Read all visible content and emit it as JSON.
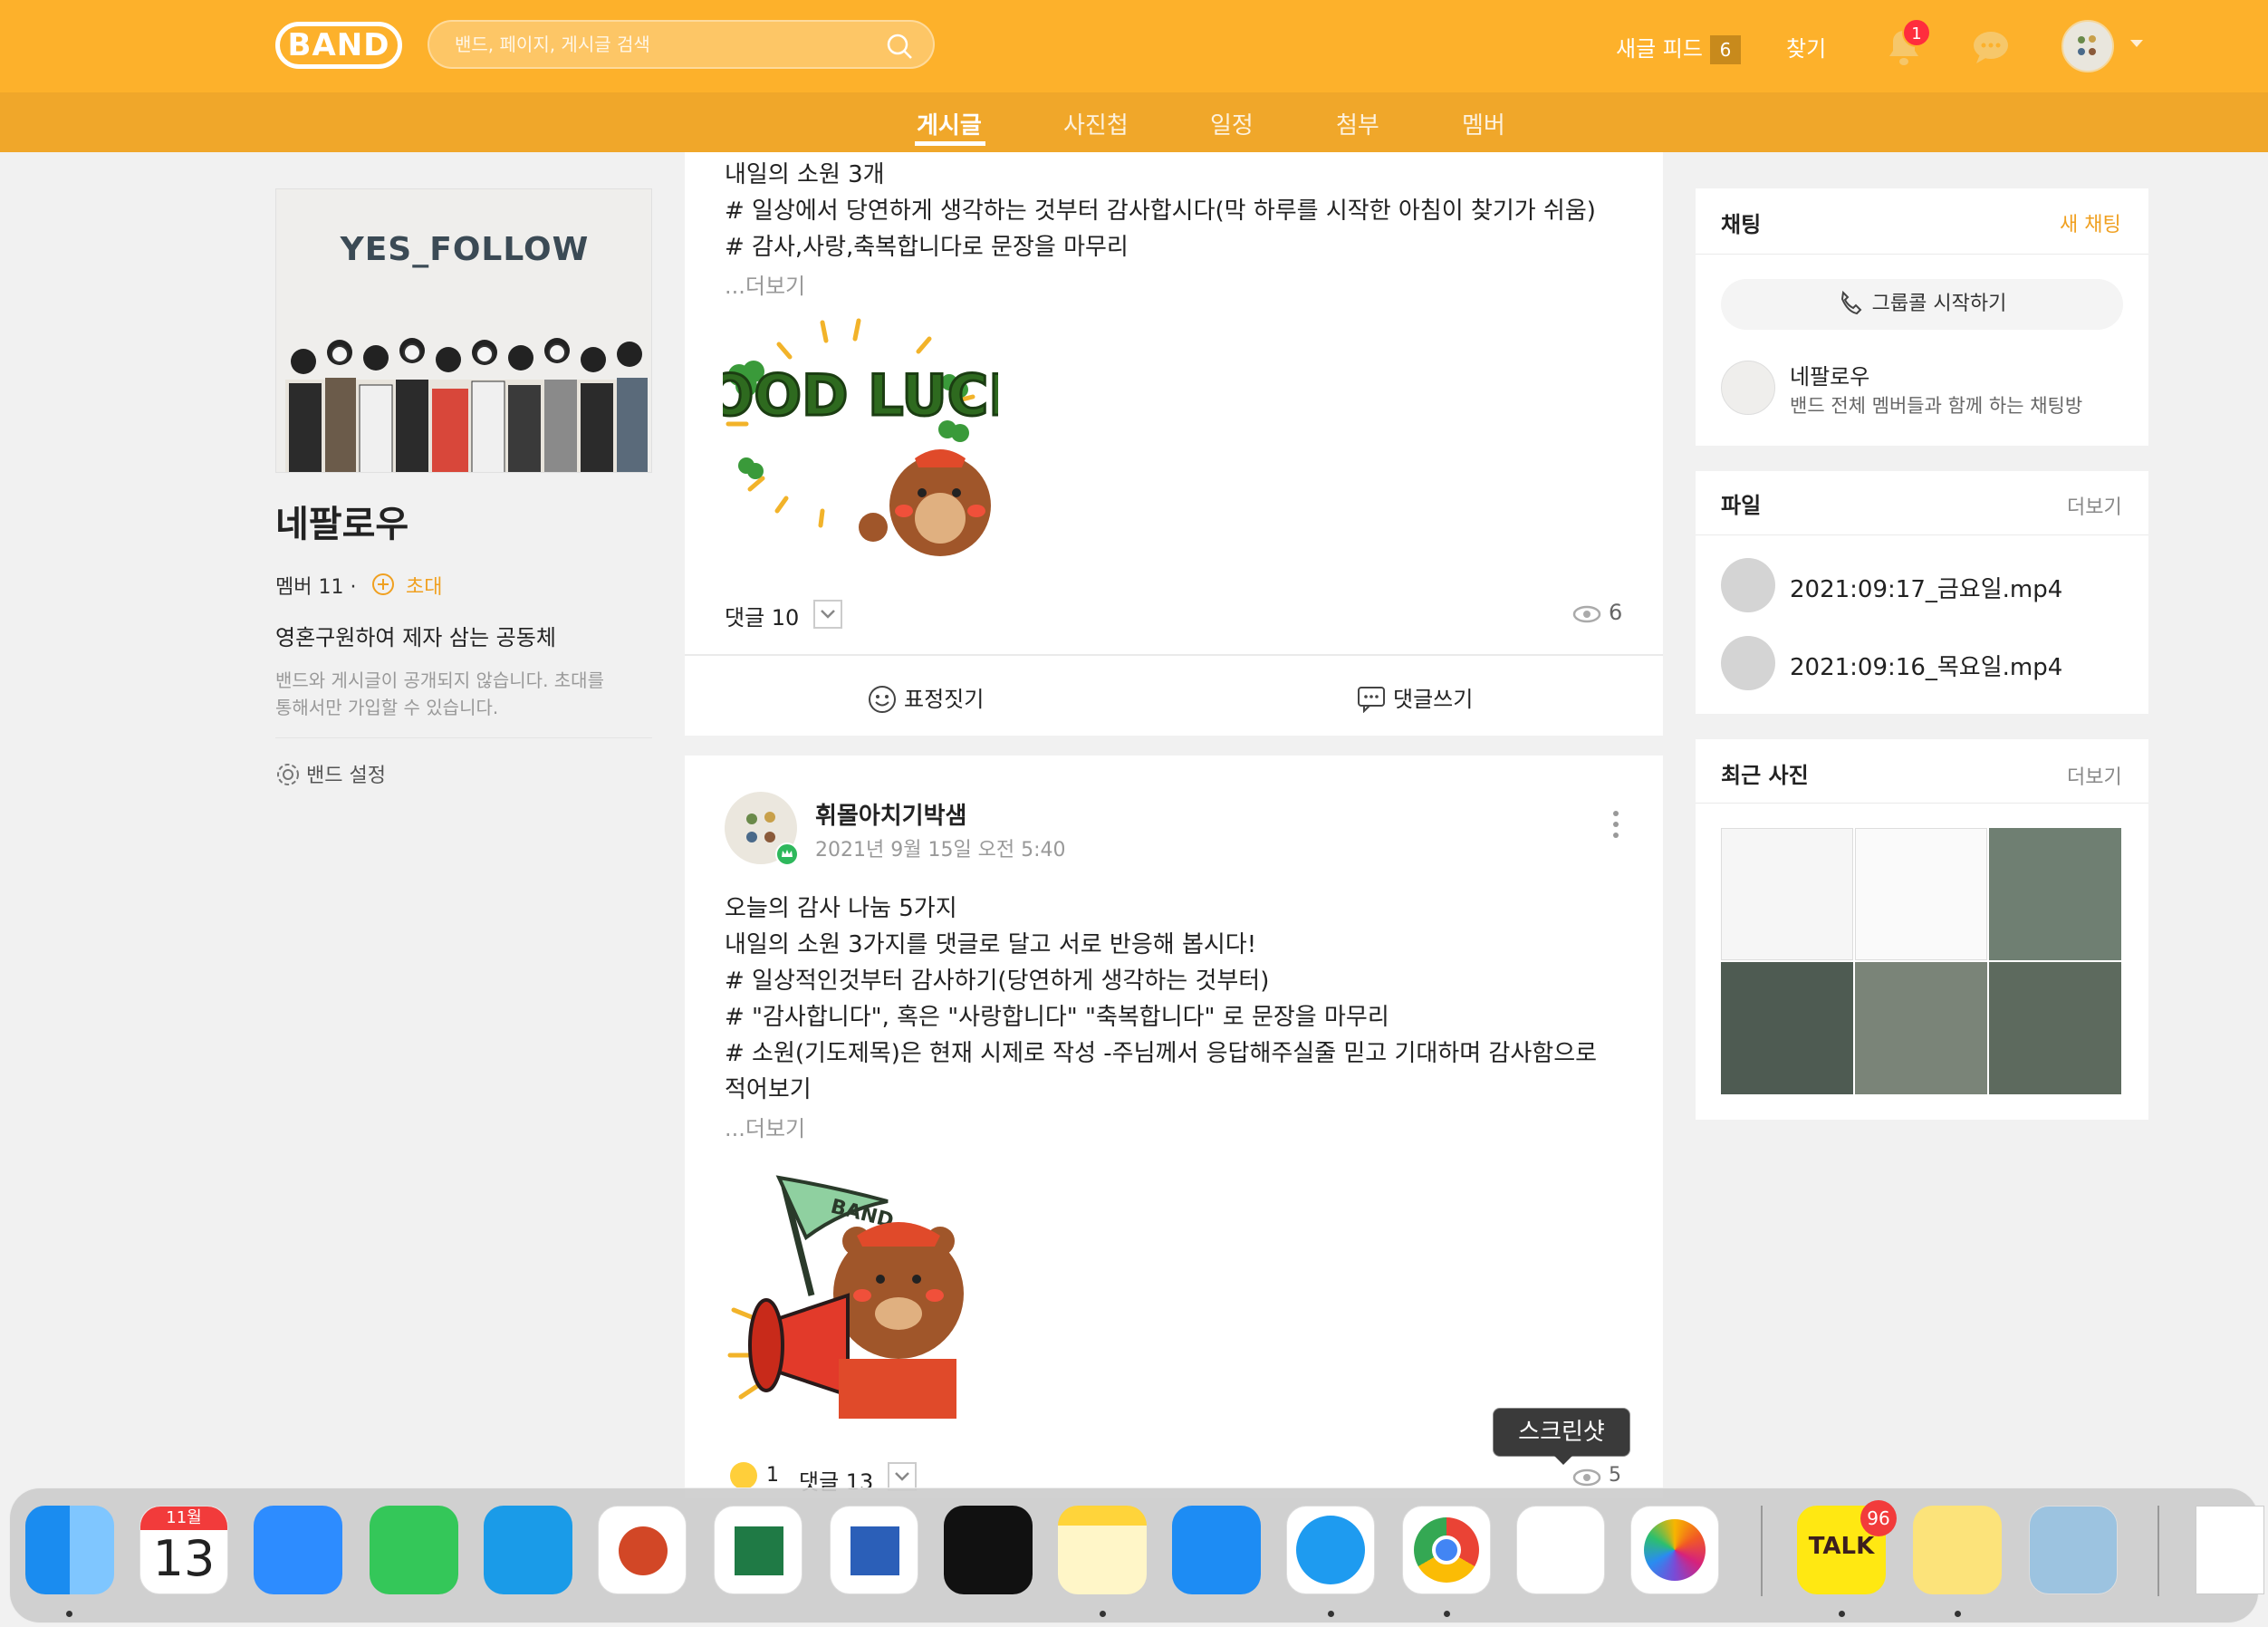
{
  "header": {
    "logo": "BAND",
    "search_placeholder": "밴드, 페이지, 게시글 검색",
    "feed_label": "새글 피드",
    "feed_count": "6",
    "find_label": "찾기",
    "notification_count": "1"
  },
  "tabs": [
    {
      "label": "게시글",
      "active": true
    },
    {
      "label": "사진첩"
    },
    {
      "label": "일정"
    },
    {
      "label": "첨부"
    },
    {
      "label": "멤버"
    }
  ],
  "band": {
    "cover_title": "YES_FOLLOW",
    "name": "네팔로우",
    "members": "멤버 11 ·",
    "invite": "초대",
    "description": "영혼구원하여 제자 삼는 공동체",
    "privacy_line1": "밴드와 게시글이 공개되지 않습니다. 초대를",
    "privacy_line2": "통해서만 가입할 수 있습니다.",
    "settings": "밴드 설정"
  },
  "post1": {
    "lines": [
      "내일의 소원 3개",
      "# 일상에서 당연하게 생각하는 것부터 감사합시다(막 하루를 시작한 아침이 찾기가 쉬움)",
      "# 감사,사랑,축복합니다로 문장을 마무리"
    ],
    "more": "...더보기",
    "sticker_text": "GOOD LUCK",
    "comments": "댓글 10",
    "views": "6",
    "react_label": "표정짓기",
    "comment_label": "댓글쓰기"
  },
  "post2": {
    "author": "휘몰아치기박샘",
    "date": "2021년 9월 15일 오전 5:40",
    "lines": [
      "오늘의 감사 나눔 5가지",
      "내일의 소원 3가지를 댓글로 달고 서로 반응해 봅시다!",
      "# 일상적인것부터 감사하기(당연하게 생각하는 것부터)",
      "# \"감사합니다\", 혹은 \"사랑합니다\" \"축복합니다\" 로 문장을 마무리",
      "#  소원(기도제목)은 현재 시제로 작성 -주님께서 응답해주실줄 믿고 기대하며 감사함으로",
      "적어보기"
    ],
    "more": "...더보기",
    "sticker_text": "BAND",
    "reaction_count": "1",
    "comments": "댓글 13",
    "views": "5"
  },
  "chat_widget": {
    "title": "채팅",
    "new_chat": "새 채팅",
    "group_call": "그룹콜 시작하기",
    "room_name": "네팔로우",
    "room_desc": "밴드 전체 멤버들과 함께 하는 채팅방"
  },
  "files_widget": {
    "title": "파일",
    "more": "더보기",
    "files": [
      "2021:09:17_금요일.mp4",
      "2021:09:16_목요일.mp4"
    ]
  },
  "photos_widget": {
    "title": "최근 사진",
    "more": "더보기"
  },
  "tooltip": "스크린샷",
  "dock": {
    "calendar_month": "11월",
    "calendar_day": "13",
    "kakao_label": "TALK",
    "kakao_badge": "96"
  },
  "colors": {
    "brand": "#fdb12b",
    "tab_bar": "#f0a72a",
    "accent_link": "#f0a020"
  }
}
